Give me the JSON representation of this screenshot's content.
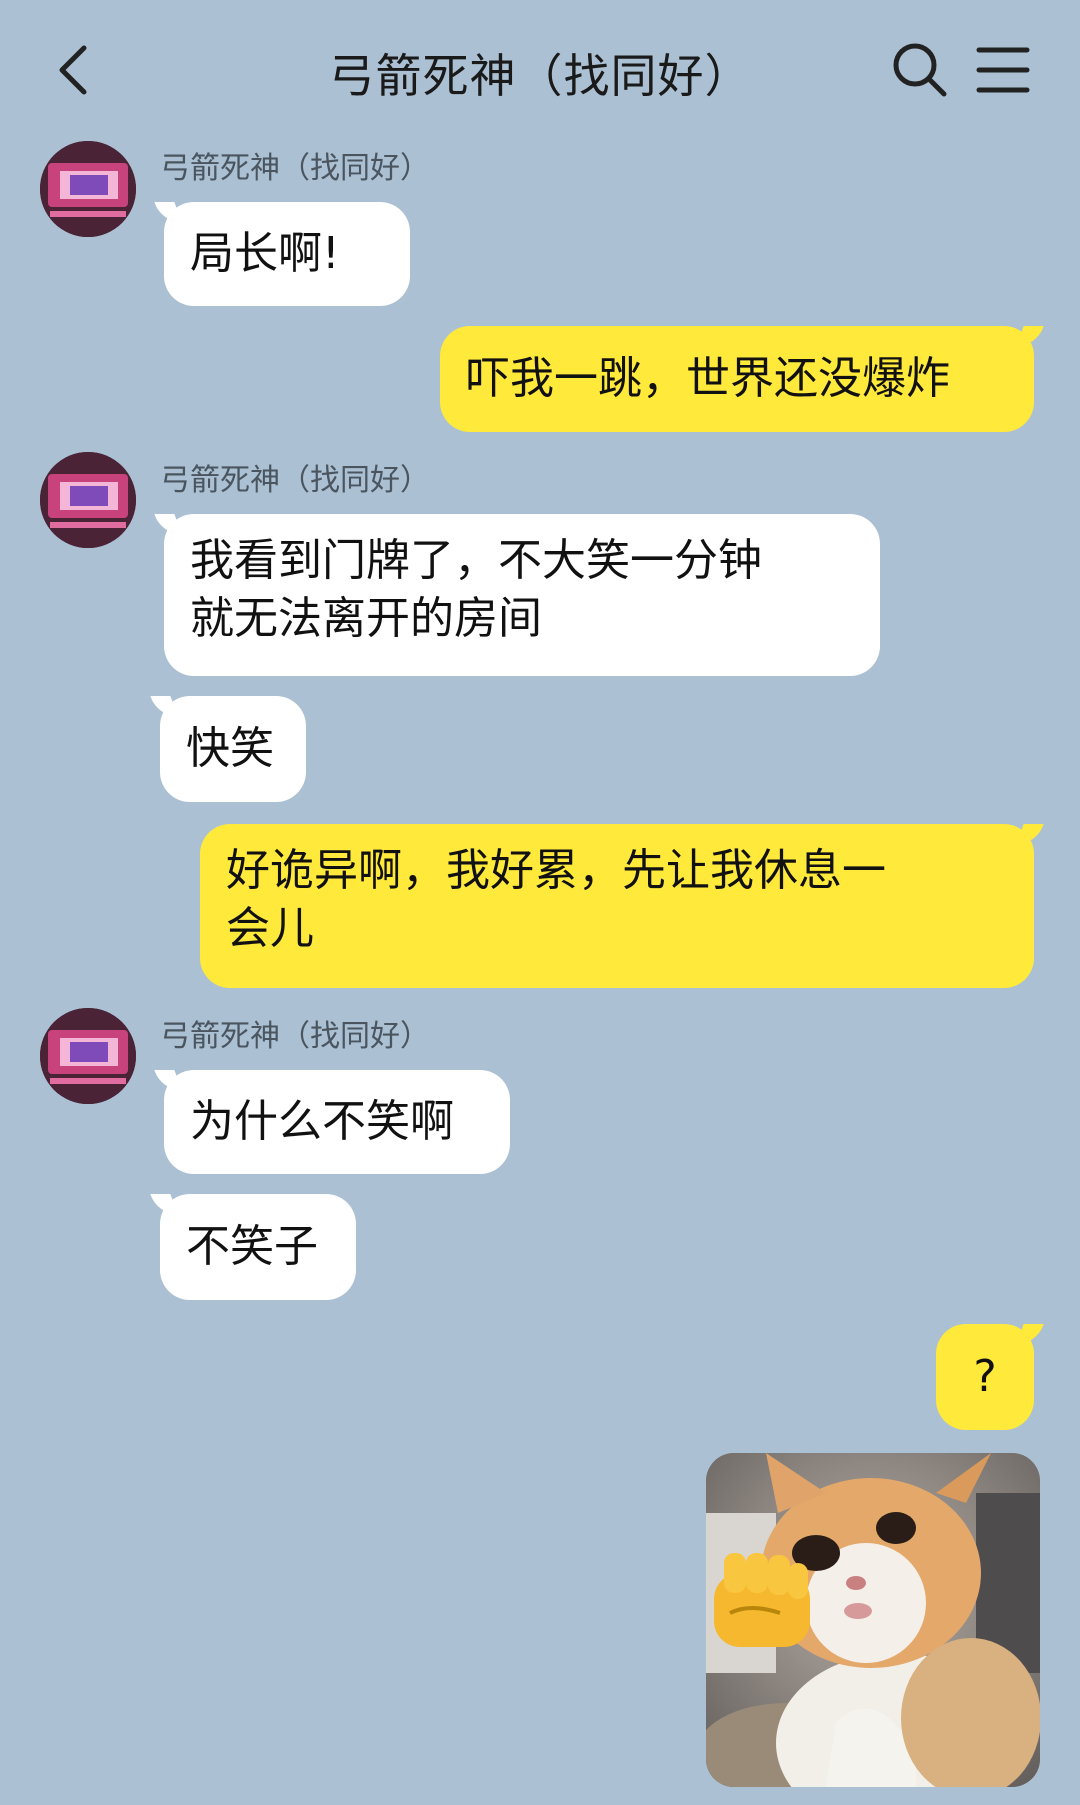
{
  "header": {
    "title": "弓箭死神（找同好）",
    "back_icon": "chevron-left-icon",
    "search_icon": "search-icon",
    "menu_icon": "menu-icon"
  },
  "messages": [
    {
      "type": "incoming",
      "sender": "弓箭死神（找同好）",
      "text": "局长啊!"
    },
    {
      "type": "outgoing",
      "text": "吓我一跳，世界还没爆炸"
    },
    {
      "type": "incoming",
      "sender": "弓箭死神（找同好）",
      "lines": [
        "我看到门牌了，不大笑一分钟",
        "就无法离开的房间"
      ]
    },
    {
      "type": "incoming",
      "text": "快笑"
    },
    {
      "type": "outgoing",
      "lines": [
        "好诡异啊，我好累，先让我休息一",
        "会儿"
      ]
    },
    {
      "type": "incoming",
      "sender": "弓箭死神（找同好）",
      "text": "为什么不笑啊"
    },
    {
      "type": "incoming",
      "text": "不笑子"
    },
    {
      "type": "outgoing",
      "text": "?"
    },
    {
      "type": "outgoing-image",
      "image": "cat-fist-sticker"
    }
  ],
  "colors": {
    "background": "#abc1d3",
    "incoming_bubble": "#ffffff",
    "outgoing_bubble": "#ffe93a"
  }
}
